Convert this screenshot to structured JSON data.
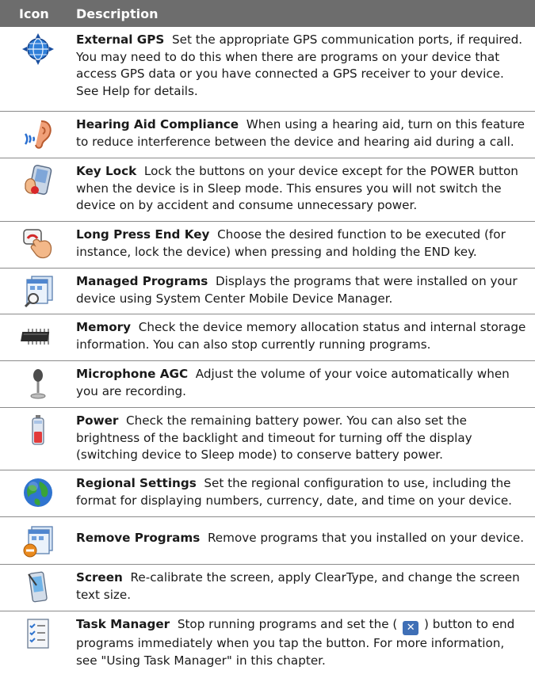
{
  "header": {
    "icon_label": "Icon",
    "description_label": "Description"
  },
  "rows": [
    {
      "title": "External GPS",
      "text": "Set the appropriate GPS communication ports, if required. You may need to do this when there are programs on your device that access GPS data or you have connected a GPS receiver to your device. See Help for details.",
      "icon": "gps-globe-icon"
    },
    {
      "title": "Hearing Aid Compliance",
      "text": "When using a hearing aid, turn on this feature to reduce interference between the device and hearing aid during a call.",
      "icon": "hearing-aid-icon"
    },
    {
      "title": "Key Lock",
      "text": "Lock the buttons on your device except for the POWER button when the device is in Sleep mode. This ensures you will not switch the device on by accident and consume unnecessary power.",
      "icon": "key-lock-icon"
    },
    {
      "title": "Long Press End Key",
      "text": "Choose the desired function to be executed (for instance, lock the device) when pressing and holding the END key.",
      "icon": "end-key-icon"
    },
    {
      "title": "Managed Programs",
      "text": "Displays the programs that were installed on your device using System Center Mobile Device Manager.",
      "icon": "managed-programs-icon"
    },
    {
      "title": "Memory",
      "text": "Check the device memory allocation status and internal storage information. You can also stop currently running programs.",
      "icon": "memory-chip-icon"
    },
    {
      "title": "Microphone AGC",
      "text": "Adjust the volume of your voice automatically when you are recording.",
      "icon": "microphone-icon"
    },
    {
      "title": "Power",
      "text": "Check the remaining battery power. You can also set the brightness of the backlight and timeout for turning off the display (switching device to Sleep mode) to conserve battery power.",
      "icon": "battery-icon"
    },
    {
      "title": "Regional Settings",
      "text": "Set the regional configuration to use, including the format for displaying numbers, currency, date, and time on your device.",
      "icon": "earth-globe-icon"
    },
    {
      "title": "Remove Programs",
      "text": "Remove programs that you installed on your device.",
      "icon": "remove-programs-icon"
    },
    {
      "title": "Screen",
      "text": "Re-calibrate the screen, apply ClearType, and change the screen text size.",
      "icon": "screen-icon"
    },
    {
      "title": "Task Manager",
      "text_before": "Stop running programs and set the (",
      "text_after": ") button to end programs immediately when you tap the button. For more information, see \"Using Task Manager\" in this chapter.",
      "inline_symbol": "✕",
      "icon": "task-manager-icon"
    }
  ]
}
